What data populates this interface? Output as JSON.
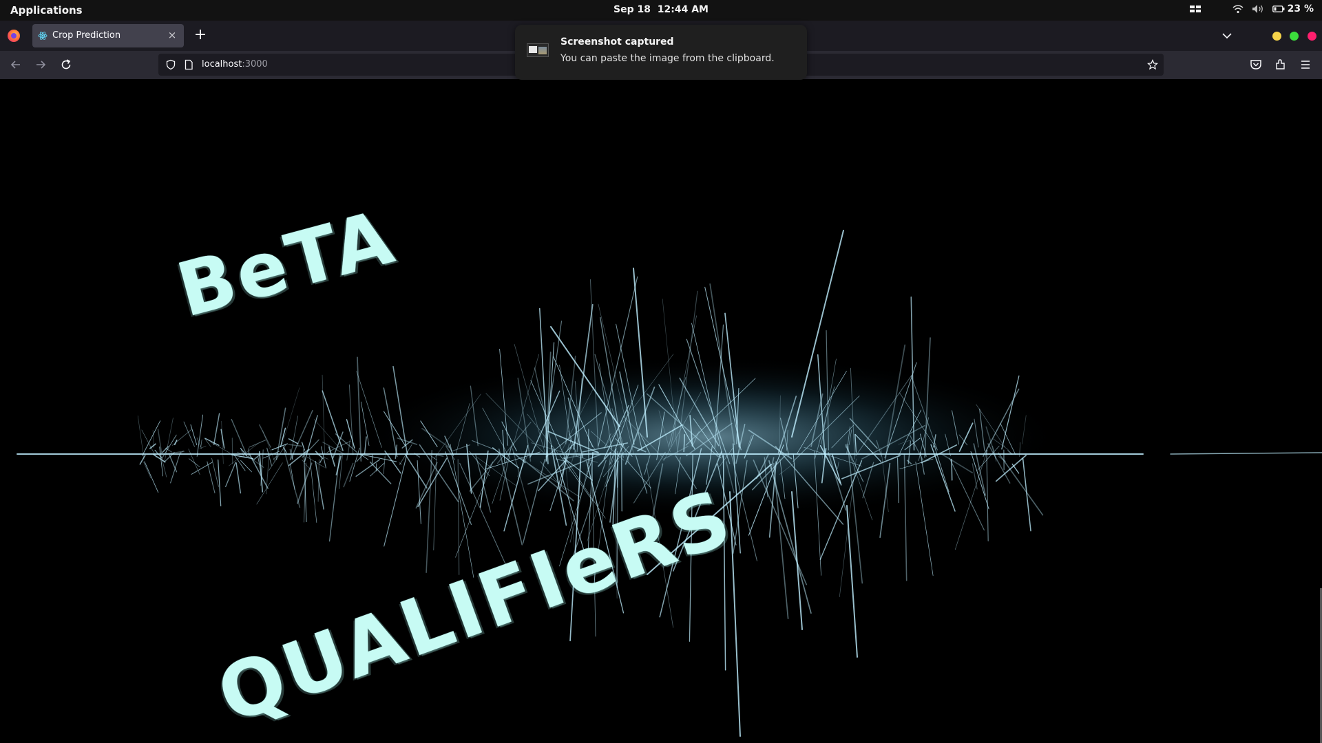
{
  "system_bar": {
    "applications_label": "Applications",
    "date": "Sep 18",
    "time": "12:44 AM",
    "battery_percent": "23 %"
  },
  "browser": {
    "tab": {
      "title": "Crop Prediction",
      "close_glyph": "×"
    },
    "new_tab_glyph": "+",
    "url": {
      "host": "localhost",
      "port": ":3000"
    },
    "window_controls": {
      "minimize_color": "#f6d44a",
      "maximize_color": "#3cdc3c",
      "close_color": "#ff1f6e"
    }
  },
  "notification": {
    "title": "Screenshot captured",
    "body": "You can paste the image from the clipboard."
  },
  "page": {
    "text_top": "BeTA",
    "text_bottom": "QUALIFIeRS",
    "accent_color": "#c7fbf4"
  }
}
